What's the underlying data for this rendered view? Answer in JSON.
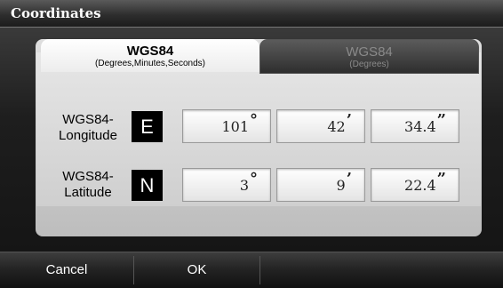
{
  "window": {
    "title": "Coordinates"
  },
  "tabs": [
    {
      "title": "WGS84",
      "subtitle": "(Degrees,Minutes,Seconds)",
      "active": true
    },
    {
      "title": "WGS84",
      "subtitle": "(Degrees)",
      "active": false
    }
  ],
  "longitude": {
    "label_line1": "WGS84-",
    "label_line2": "Longitude",
    "direction": "E",
    "degrees": "101",
    "degrees_unit": "°",
    "minutes": "42",
    "minutes_unit": "’",
    "seconds": "34.4",
    "seconds_unit": "”"
  },
  "latitude": {
    "label_line1": "WGS84-",
    "label_line2": "Latitude",
    "direction": "N",
    "degrees": "3",
    "degrees_unit": "°",
    "minutes": "9",
    "minutes_unit": "’",
    "seconds": "22.4",
    "seconds_unit": "”"
  },
  "buttons": {
    "cancel": "Cancel",
    "ok": "OK"
  }
}
